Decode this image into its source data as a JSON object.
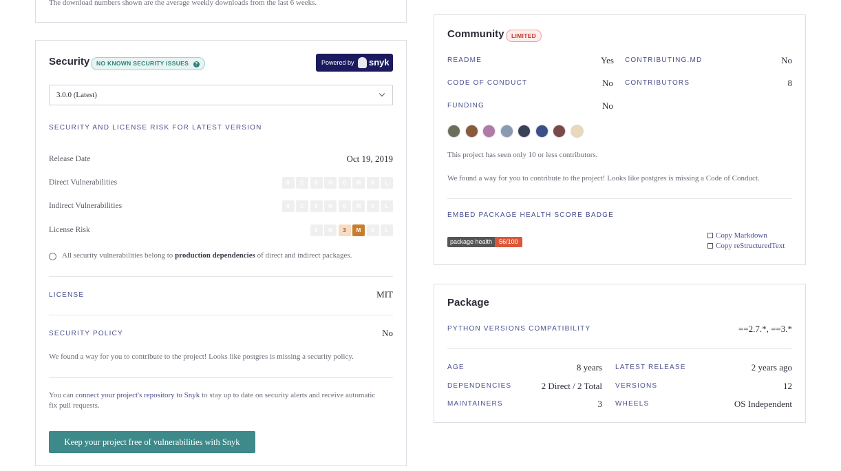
{
  "download_note": "The download numbers shown are the average weekly downloads from the last 6 weeks.",
  "security": {
    "title": "Security",
    "badge": "NO KNOWN SECURITY ISSUES",
    "badge_help": "?",
    "powered_by": "Powered by",
    "snyk": "snyk",
    "version_select": "3.0.0 (Latest)",
    "risk_heading": "SECURITY AND LICENSE RISK FOR LATEST VERSION",
    "release_date_label": "Release Date",
    "release_date": "Oct 19, 2019",
    "direct_label": "Direct Vulnerabilities",
    "indirect_label": "Indirect Vulnerabilities",
    "license_risk_label": "License Risk",
    "direct_sev": [
      "0",
      "C",
      "0",
      "H",
      "0",
      "M",
      "0",
      "L"
    ],
    "indirect_sev": [
      "0",
      "C",
      "0",
      "H",
      "0",
      "M",
      "0",
      "L"
    ],
    "license_sev": [
      "0",
      "H",
      "3",
      "M",
      "0",
      "L"
    ],
    "note_pre": "All security vulnerabilities belong to ",
    "note_bold": "production dependencies",
    "note_post": " of direct and indirect packages.",
    "license_label": "LICENSE",
    "license_value": "MIT",
    "policy_label": "SECURITY POLICY",
    "policy_value": "No",
    "policy_note": "We found a way for you to contribute to the project! Looks like postgres is missing a security policy.",
    "connect_pre": "You can ",
    "connect_link": "connect your project's repository to Snyk",
    "connect_post": " to stay up to date on security alerts and receive automatic fix pull requests.",
    "cta": "Keep your project free of vulnerabilities with Snyk"
  },
  "community": {
    "title": "Community",
    "badge": "LIMITED",
    "readme_label": "README",
    "readme": "Yes",
    "contributing_label": "CONTRIBUTING.MD",
    "contributing": "No",
    "coc_label": "CODE OF CONDUCT",
    "coc": "No",
    "contributors_label": "CONTRIBUTORS",
    "contributors": "8",
    "funding_label": "FUNDING",
    "funding": "No",
    "avatar_colors": [
      "#6b6f5a",
      "#8a5a3c",
      "#b07aa6",
      "#8a9ab0",
      "#3a4258",
      "#3c4f8a",
      "#7a4a4a",
      "#e8d9b8"
    ],
    "note1": "This project has seen only 10 or less contributors.",
    "note2": "We found a way for you to contribute to the project! Looks like postgres is missing a Code of Conduct.",
    "embed_heading": "EMBED PACKAGE HEALTH SCORE BADGE",
    "health_label": "package health",
    "health_value": "56/100",
    "copy_md": "Copy Markdown",
    "copy_rst": "Copy reStructuredText"
  },
  "package": {
    "title": "Package",
    "python_label": "PYTHON VERSIONS COMPATIBILITY",
    "python": "==2.7.*, ==3.*",
    "age_label": "AGE",
    "age": "8 years",
    "latest_label": "LATEST RELEASE",
    "latest": "2 years ago",
    "deps_label": "DEPENDENCIES",
    "deps": "2 Direct / 2 Total",
    "versions_label": "VERSIONS",
    "versions": "12",
    "maint_label": "MAINTAINERS",
    "maint": "3",
    "wheels_label": "WHEELS",
    "wheels": "OS Independent"
  },
  "colors": {
    "accent": "#4b4f8f",
    "cta_bg": "#3e8a8a",
    "snyk_bg": "#1b1a5e",
    "health_dark": "#555555",
    "health_score": "#d9583b"
  }
}
